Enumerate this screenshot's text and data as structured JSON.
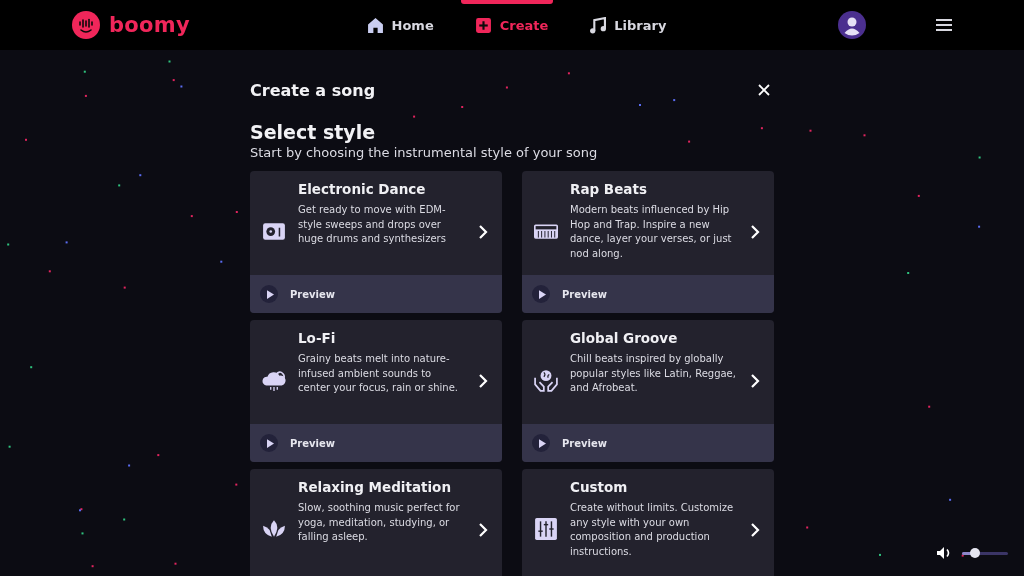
{
  "header": {
    "logo": "boomy",
    "nav": [
      {
        "label": "Home",
        "selected": false
      },
      {
        "label": "Create",
        "selected": true
      },
      {
        "label": "Library",
        "selected": false
      }
    ]
  },
  "dialog": {
    "title": "Create a song",
    "heading": "Select style",
    "subtitle": "Start by choosing the instrumental style of your song",
    "styles": [
      {
        "name": "Electronic Dance",
        "description": "Get ready to move with EDM-style sweeps and drops over huge drums and synthesizers",
        "preview": "Preview"
      },
      {
        "name": "Rap Beats",
        "description": "Modern beats influenced by Hip Hop and Trap. Inspire a new dance, layer your verses, or just nod along.",
        "preview": "Preview"
      },
      {
        "name": "Lo-Fi",
        "description": "Grainy beats melt into nature-infused ambient sounds to center your focus, rain or shine.",
        "preview": "Preview"
      },
      {
        "name": "Global Groove",
        "description": "Chill beats inspired by globally popular styles like Latin, Reggae, and Afrobeat.",
        "preview": "Preview"
      },
      {
        "name": "Relaxing Meditation",
        "description": "Slow, soothing music perfect for yoga, meditation, studying, or falling asleep."
      },
      {
        "name": "Custom",
        "description": "Create without limits. Customize any style with your own composition and production instructions."
      }
    ]
  },
  "volume": {
    "level": 0.28
  }
}
